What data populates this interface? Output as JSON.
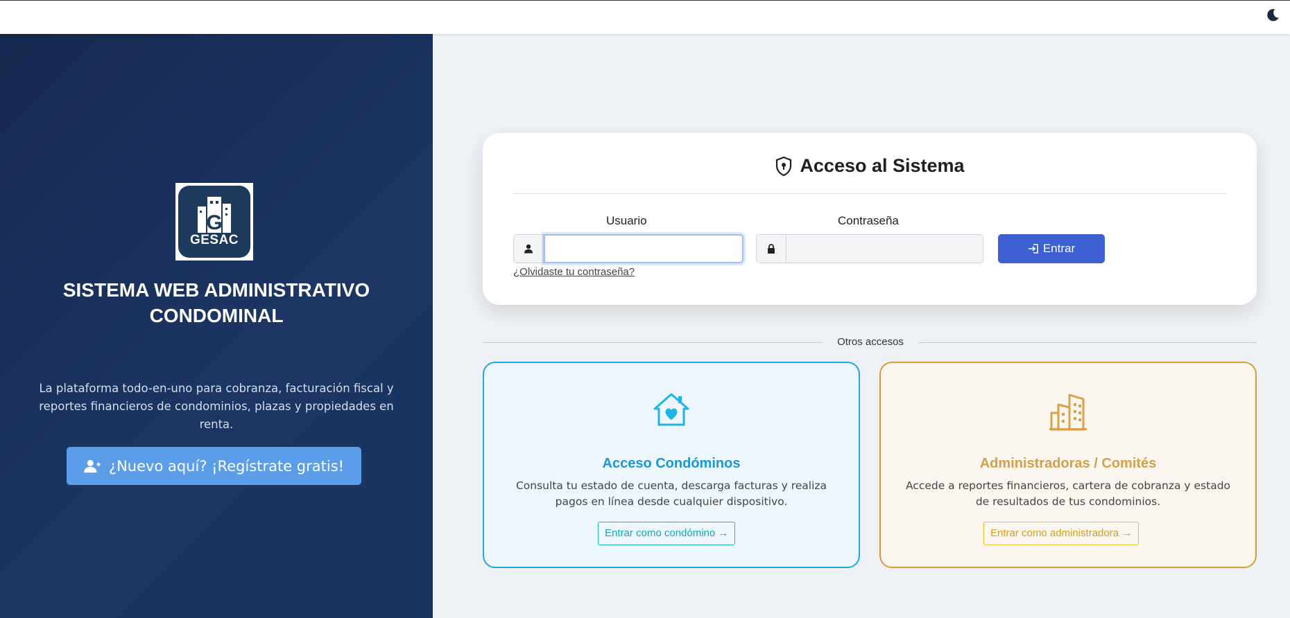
{
  "header": {
    "theme_toggle_icon": "moon-icon"
  },
  "branding": {
    "logo_text": "GESAC",
    "logo_letter": "G",
    "title": "SISTEMA WEB ADMINISTRATIVO CONDOMINAL",
    "description": "La plataforma todo-en-uno para cobranza, facturación fiscal y reportes financieros de condominios, plazas y propiedades en renta.",
    "register_label": "¿Nuevo aquí? ¡Regístrate gratis!",
    "colors": {
      "panel": "#1c3563",
      "register": "#5b9de9"
    }
  },
  "login": {
    "title": "Acceso al Sistema",
    "user_label": "Usuario",
    "user_value": "",
    "password_label": "Contraseña",
    "password_value": "",
    "submit_label": "Entrar",
    "forgot_label": "¿Olvidaste tu contraseña?",
    "colors": {
      "submit": "#3d5fd1"
    }
  },
  "others": {
    "label": "Otros accesos",
    "cards": [
      {
        "title": "Acceso Condóminos",
        "description": "Consulta tu estado de cuenta, descarga facturas y realiza pagos en línea desde cualquier dispositivo.",
        "link_label": "Entrar como condómino →",
        "icon": "house-heart-icon",
        "accent": "#1ea7e8"
      },
      {
        "title": "Administradoras / Comités",
        "description": "Accede a reportes financieros, cartera de cobranza y estado de resultados de tus condominios.",
        "link_label": "Entrar como administradora →",
        "icon": "buildings-icon",
        "accent": "#d89b38"
      }
    ]
  }
}
